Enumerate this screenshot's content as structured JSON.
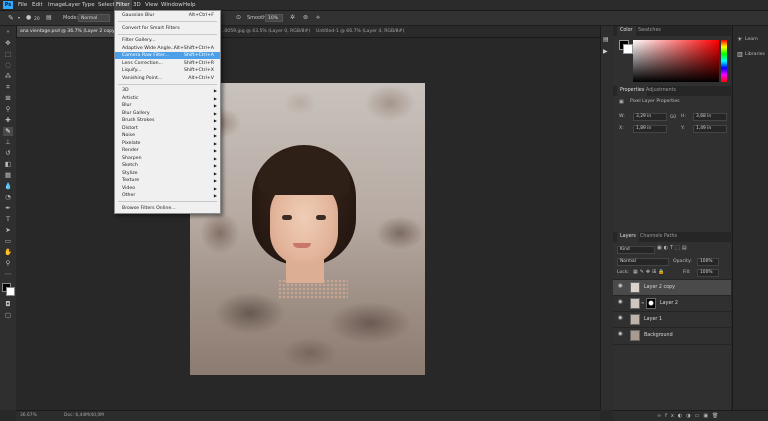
{
  "menubar": {
    "logo": "Ps",
    "items": [
      "File",
      "Edit",
      "Image",
      "Layer",
      "Type",
      "Select",
      "Filter",
      "3D",
      "View",
      "Window",
      "Help"
    ],
    "active_item": "Filter"
  },
  "options_bar": {
    "brush_size": "20",
    "mode_label": "Mode:",
    "mode_value": "Normal",
    "smoothing_label": "Smoothing:",
    "smoothing_value": "10%"
  },
  "tabs": [
    {
      "label": "ana vientage.psd @ 36.7% (Layer 2 copy, RGB/8",
      "active": true
    },
    {
      "label": "...0059.jpg @ 43.5% (Layer 0, RGB/8#)",
      "active": false
    },
    {
      "label": "Untitled-1 @ 66.7% (Layer 4, RGB/8#)",
      "active": false
    }
  ],
  "filter_menu": {
    "items": [
      {
        "label": "Gaussian Blur",
        "shortcut": "Alt+Ctrl+F",
        "submenu": false,
        "sep_after": true
      },
      {
        "label": "Convert for Smart Filters",
        "shortcut": "",
        "submenu": false,
        "sep_after": true
      },
      {
        "label": "Filter Gallery...",
        "shortcut": "",
        "submenu": false
      },
      {
        "label": "Adaptive Wide Angle...",
        "shortcut": "Alt+Shift+Ctrl+A",
        "submenu": false
      },
      {
        "label": "Camera Raw Filter...",
        "shortcut": "Shift+Ctrl+A",
        "submenu": false,
        "highlight": true
      },
      {
        "label": "Lens Correction...",
        "shortcut": "Shift+Ctrl+R",
        "submenu": false
      },
      {
        "label": "Liquify...",
        "shortcut": "Shift+Ctrl+X",
        "submenu": false
      },
      {
        "label": "Vanishing Point...",
        "shortcut": "Alt+Ctrl+V",
        "submenu": false,
        "sep_after": true
      },
      {
        "label": "3D",
        "submenu": true
      },
      {
        "label": "Artistic",
        "submenu": true
      },
      {
        "label": "Blur",
        "submenu": true
      },
      {
        "label": "Blur Gallery",
        "submenu": true
      },
      {
        "label": "Brush Strokes",
        "submenu": true
      },
      {
        "label": "Distort",
        "submenu": true
      },
      {
        "label": "Noise",
        "submenu": true
      },
      {
        "label": "Pixelate",
        "submenu": true
      },
      {
        "label": "Render",
        "submenu": true
      },
      {
        "label": "Sharpen",
        "submenu": true
      },
      {
        "label": "Sketch",
        "submenu": true
      },
      {
        "label": "Stylize",
        "submenu": true
      },
      {
        "label": "Texture",
        "submenu": true
      },
      {
        "label": "Video",
        "submenu": true
      },
      {
        "label": "Other",
        "submenu": true,
        "sep_after": true
      },
      {
        "label": "Browse Filters Online...",
        "submenu": false
      }
    ]
  },
  "color_panel": {
    "tabs": [
      "Color",
      "Swatches"
    ]
  },
  "properties_panel": {
    "tabs": [
      "Properties",
      "Adjustments"
    ],
    "header": "Pixel Layer Properties",
    "w_label": "W:",
    "w_value": "3,29 in",
    "h_label": "H:",
    "h_value": "3,68 in",
    "x_label": "X:",
    "x_value": "1,89 in",
    "y_label": "Y:",
    "y_value": "1,49 in",
    "link_label": "GO"
  },
  "layers_panel": {
    "tabs": [
      "Layers",
      "Channels",
      "Paths"
    ],
    "filter_kind": "Kind",
    "blend_mode": "Normal",
    "opacity_label": "Opacity:",
    "opacity_value": "100%",
    "lock_label": "Lock:",
    "fill_label": "Fill:",
    "fill_value": "100%",
    "layers": [
      {
        "name": "Layer 2 copy",
        "selected": true
      },
      {
        "name": "Layer 2",
        "selected": false
      },
      {
        "name": "Layer 1",
        "selected": false
      },
      {
        "name": "Background",
        "selected": false
      }
    ]
  },
  "right_dock": {
    "items": [
      "Learn",
      "Libraries"
    ]
  },
  "statusbar": {
    "zoom": "36.67%",
    "doc_info": "Doc: 6,44M/40,0M"
  },
  "colors": {
    "accent": "#4da0e8",
    "brand": "#31a8ff"
  }
}
